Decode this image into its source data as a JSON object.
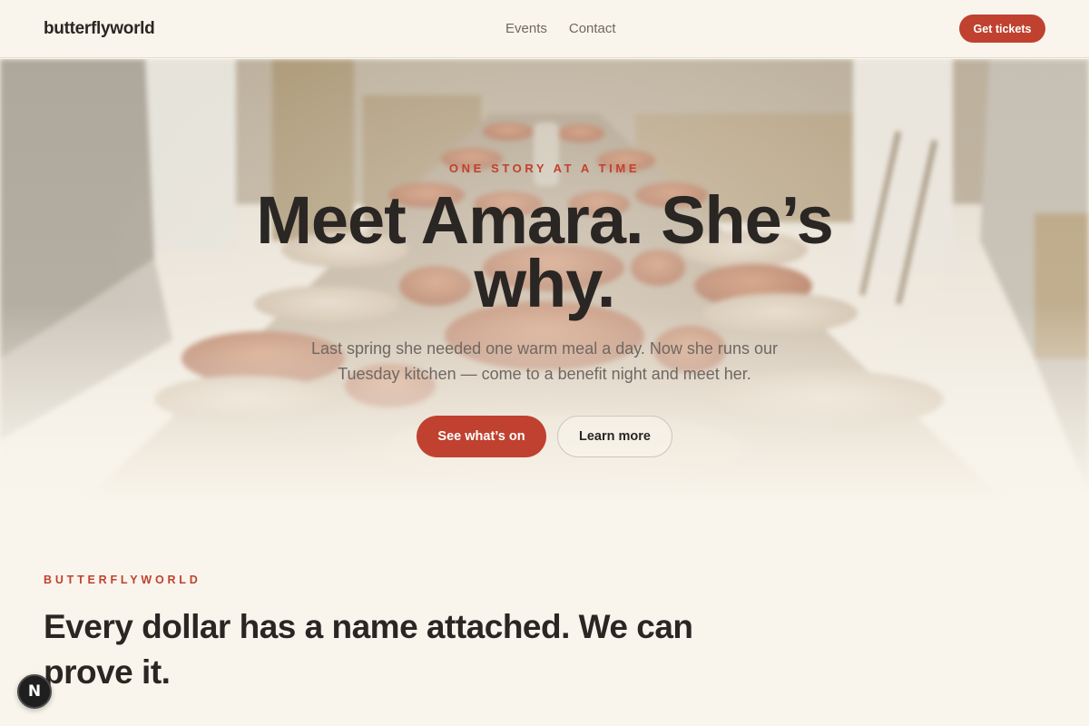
{
  "header": {
    "logo": "butterflyworld",
    "nav": [
      {
        "label": "Events"
      },
      {
        "label": "Contact"
      }
    ],
    "cta_label": "Get tickets"
  },
  "hero": {
    "eyebrow": "ONE STORY AT A TIME",
    "title": "Meet Amara. She’s why.",
    "subtitle": "Last spring she needed one warm meal a day. Now she runs our Tuesday kitchen — come to a benefit night and meet her.",
    "primary_label": "See what’s on",
    "secondary_label": "Learn more"
  },
  "mission": {
    "eyebrow": "BUTTERFLYWORLD",
    "title": "Every dollar has a name attached. We can prove it."
  },
  "badge": {
    "letter": "N"
  },
  "colors": {
    "accent": "#c0412f",
    "background": "#f9f5ec",
    "text": "#2a2624",
    "muted": "#6f6862"
  }
}
